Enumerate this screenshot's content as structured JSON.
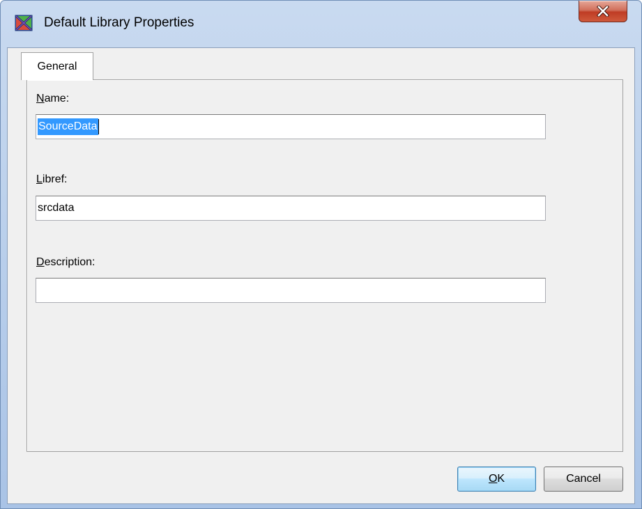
{
  "window": {
    "title": "Default Library Properties",
    "app_icon": "sas-library-icon",
    "close_icon": "close-x-icon"
  },
  "tabs": [
    {
      "label": "General",
      "selected": true
    }
  ],
  "form": {
    "name": {
      "label_accel": "N",
      "label_pre": "",
      "label_post": "ame:",
      "value": "SourceData",
      "selected": true
    },
    "libref": {
      "label_accel": "L",
      "label_pre": "",
      "label_post": "ibref:",
      "value": "srcdata"
    },
    "description": {
      "label_accel": "D",
      "label_pre": "",
      "label_post": "escription:",
      "value": ""
    }
  },
  "buttons": {
    "ok_accel": "O",
    "ok_rest": "K",
    "cancel": "Cancel"
  },
  "colors": {
    "selection": "#3399ff",
    "close_button": "#c8452e",
    "dialog_background": "#f0f0f0"
  }
}
